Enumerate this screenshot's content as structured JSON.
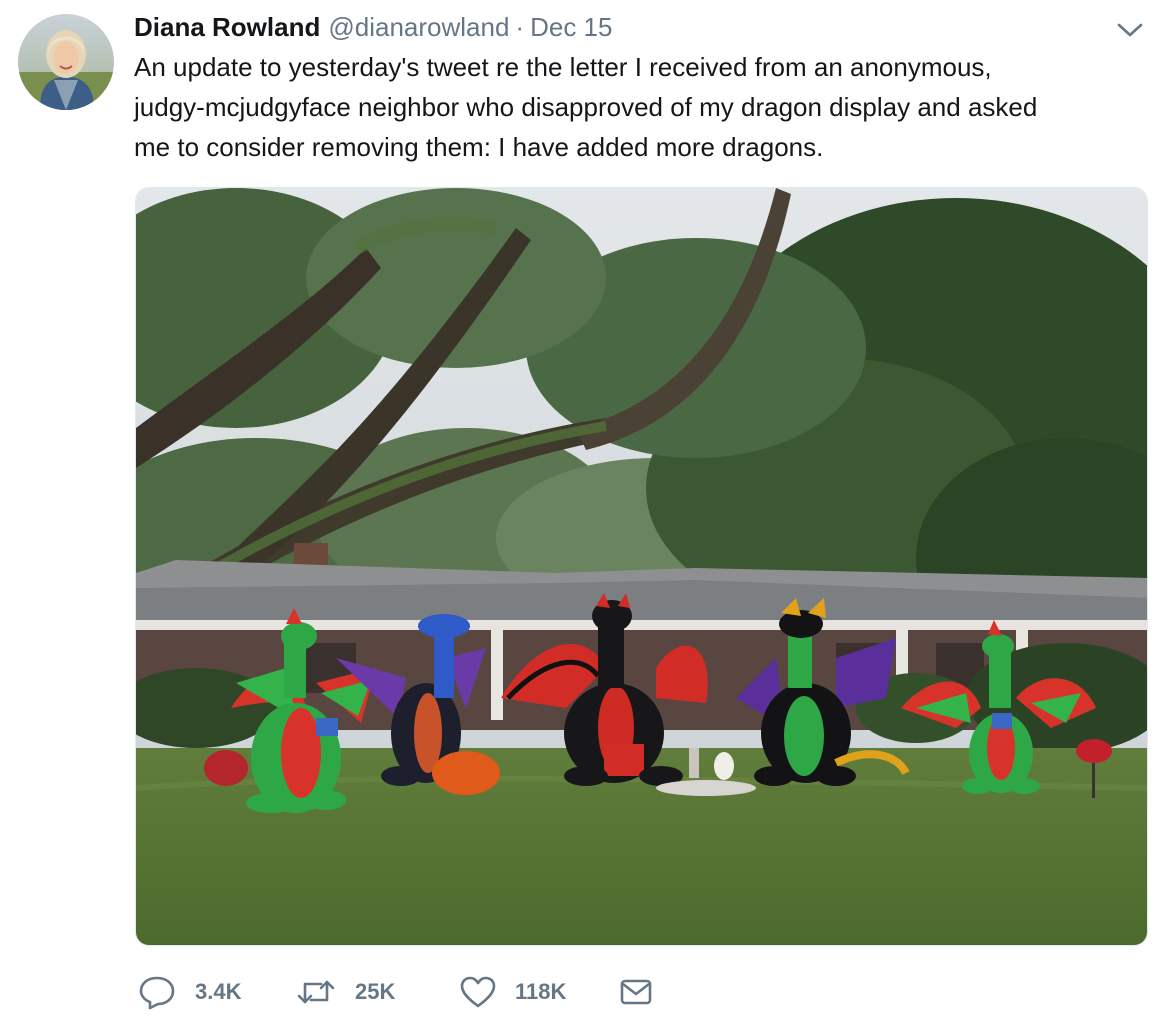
{
  "author": {
    "name": "Diana Rowland",
    "handle": "@dianarowland",
    "separator": "·",
    "date": "Dec 15"
  },
  "tweet": {
    "text_lines": [
      "An update to yesterday's tweet re the letter I received from an anonymous,",
      "judgy-mcjudgyface neighbor who disapproved of my dragon display and asked",
      "me to consider removing them: I have added more dragons."
    ]
  },
  "media": {
    "description_icon": "photo"
  },
  "actions": {
    "reply": {
      "icon": "reply-icon",
      "count": "3.4K"
    },
    "retweet": {
      "icon": "retweet-icon",
      "count": "25K"
    },
    "like": {
      "icon": "heart-icon",
      "count": "118K"
    },
    "message": {
      "icon": "envelope-icon"
    }
  },
  "colors": {
    "text": "#14171a",
    "secondary": "#657786",
    "border": "#e1e8ed"
  }
}
